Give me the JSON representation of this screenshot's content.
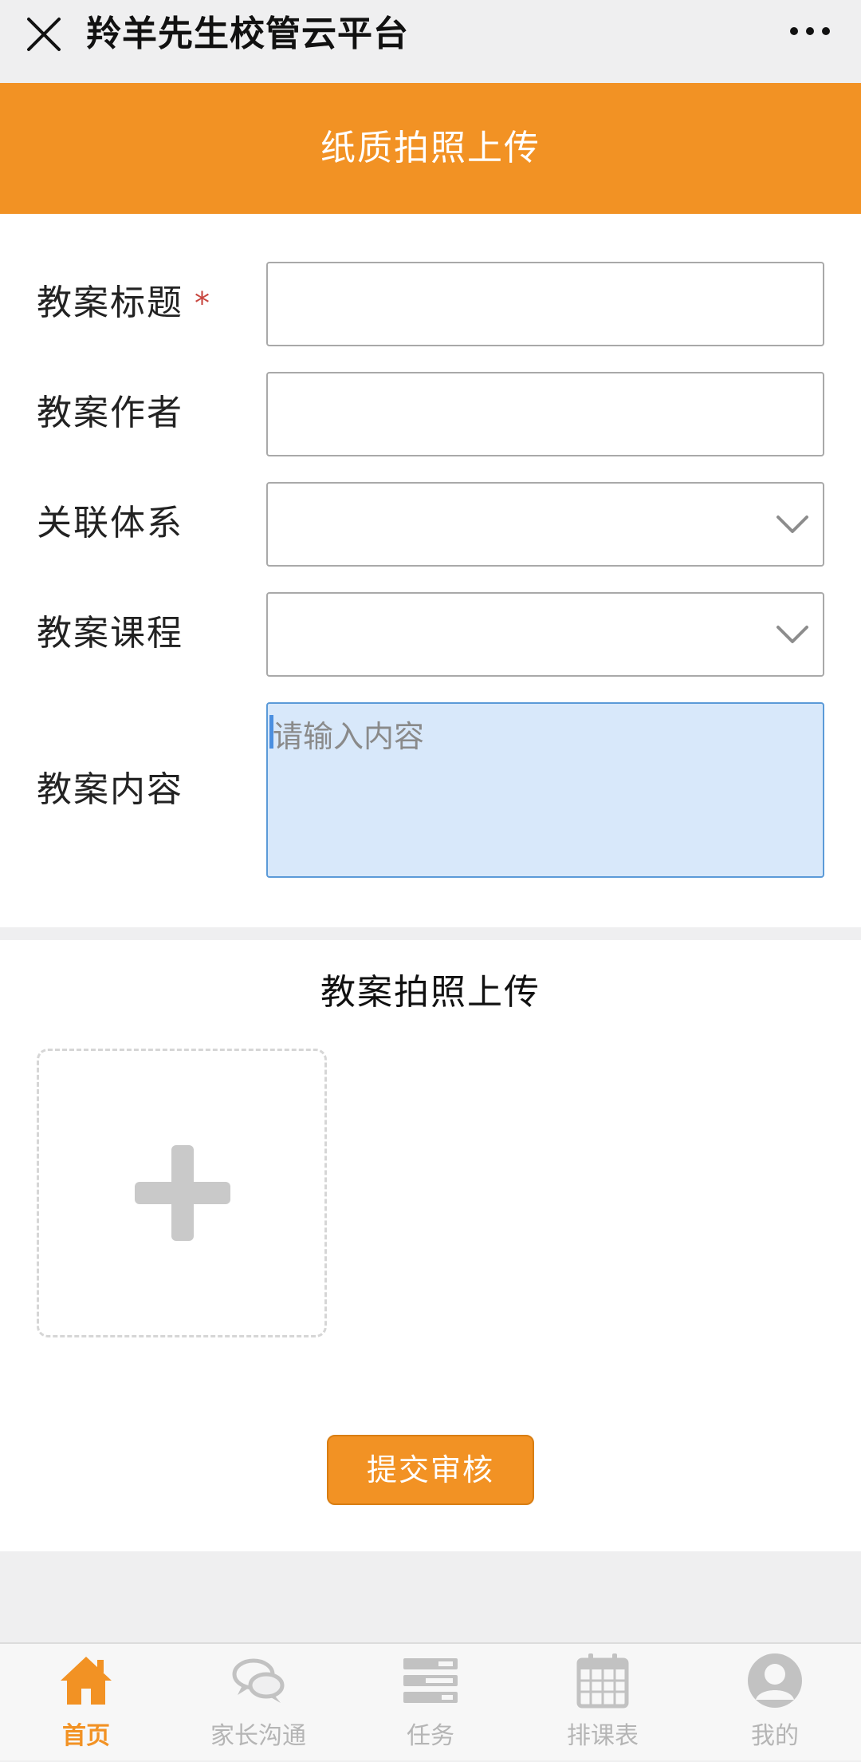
{
  "titlebar": {
    "title": "羚羊先生校管云平台"
  },
  "banner": {
    "title": "纸质拍照上传"
  },
  "form": {
    "title_label": "教案标题",
    "required_mark": "*",
    "author_label": "教案作者",
    "system_label": "关联体系",
    "course_label": "教案课程",
    "content_label": "教案内容",
    "content_placeholder": "请输入内容"
  },
  "upload": {
    "title": "教案拍照上传"
  },
  "submit": {
    "label": "提交审核"
  },
  "tabs": [
    {
      "label": "首页",
      "icon": "home-icon",
      "active": true
    },
    {
      "label": "家长沟通",
      "icon": "chat-icon",
      "active": false
    },
    {
      "label": "任务",
      "icon": "task-list-icon",
      "active": false
    },
    {
      "label": "排课表",
      "icon": "calendar-icon",
      "active": false
    },
    {
      "label": "我的",
      "icon": "user-icon",
      "active": false
    }
  ],
  "colors": {
    "accent": "#f29224",
    "inactive": "#b5b5b5",
    "textarea_bg": "#d8e8fa",
    "required": "#c8463f"
  }
}
